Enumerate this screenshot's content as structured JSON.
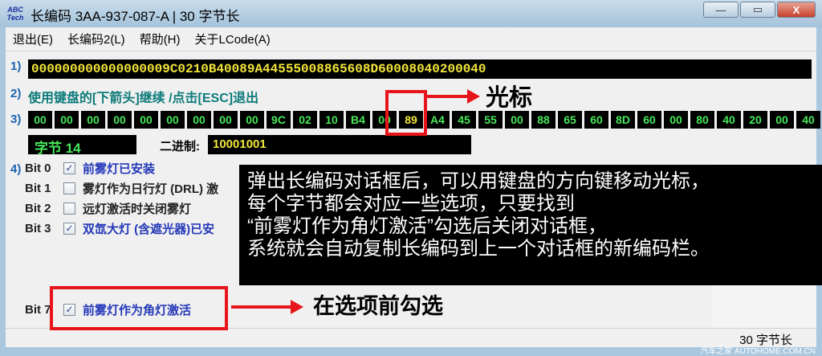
{
  "window": {
    "logo_text": "ABC Tech",
    "title": "长编码  3AA-937-087-A | 30 字节长",
    "buttons": {
      "minimize": "—",
      "maximize": "▭",
      "close": "X"
    }
  },
  "menu": [
    "退出(E)",
    "长编码2(L)",
    "帮助(H)",
    "关于LCode(A)"
  ],
  "section1": {
    "num": "1)",
    "code": "000000000000000009C0210B40089A44555008865608D60008040200040"
  },
  "section2": {
    "num": "2)",
    "text": "使用键盘的[下箭头]继续 /点击[ESC]退出"
  },
  "section3": {
    "num": "3)",
    "bytes": [
      "00",
      "00",
      "00",
      "00",
      "00",
      "00",
      "00",
      "00",
      "00",
      "9C",
      "02",
      "10",
      "B4",
      "00",
      "89",
      "A4",
      "45",
      "55",
      "00",
      "88",
      "65",
      "60",
      "8D",
      "60",
      "00",
      "80",
      "40",
      "20",
      "00",
      "40"
    ],
    "selected_index": 14
  },
  "byte_info": {
    "byte_label": "字节 14",
    "binary_label": "二进制:",
    "binary_value": "10001001"
  },
  "section4": {
    "num": "4)",
    "bits": [
      {
        "label": "Bit 0",
        "checked": "✓",
        "text": "前雾灯已安装",
        "color": "blue"
      },
      {
        "label": "Bit 1",
        "checked": "",
        "text": "雾灯作为日行灯 (DRL) 激",
        "color": "dark"
      },
      {
        "label": "Bit 2",
        "checked": "",
        "text": "远灯激活时关闭雾灯",
        "color": "dark"
      },
      {
        "label": "Bit 3",
        "checked": "✓",
        "text": "双氙大灯 (含遮光器)已安",
        "color": "blue"
      },
      {
        "label": "Bit 7",
        "checked": "✓",
        "text": "前雾灯作为角灯激活",
        "color": "blue"
      }
    ]
  },
  "status": "30 字节长",
  "annotations": {
    "cursor_label": "光标",
    "check_label": "在选项前勾选",
    "callout_lines": [
      "弹出长编码对话框后，可以用键盘的方向键移动光标，",
      "每个字节都会对应一些选项，只要找到",
      "“前雾灯作为角灯激活”勾选后关闭对话框，",
      "系统就会自动复制长编码到上一个对话框的新编码栏。"
    ],
    "accent_color": "#e8141b"
  },
  "watermark": "汽车之家  AUTOHOME.COM.CN"
}
